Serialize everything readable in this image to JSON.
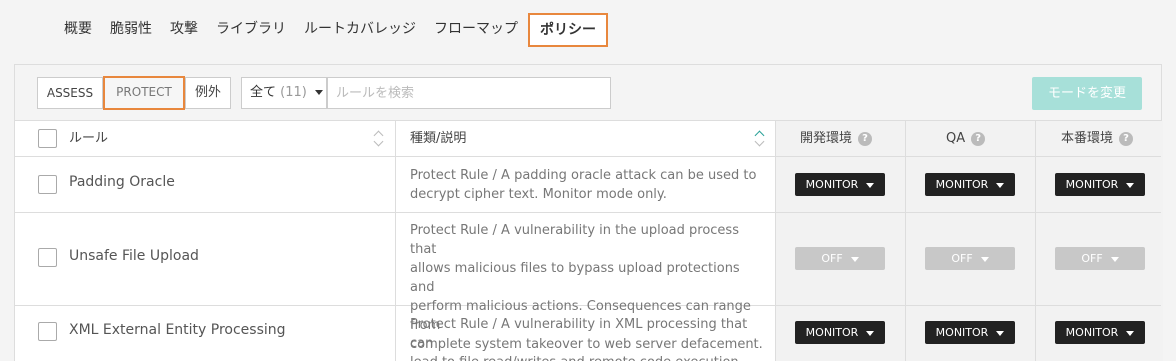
{
  "tabs": [
    {
      "label": "概要"
    },
    {
      "label": "脆弱性"
    },
    {
      "label": "攻撃"
    },
    {
      "label": "ライブラリ"
    },
    {
      "label": "ルートカバレッジ"
    },
    {
      "label": "フローマップ"
    },
    {
      "label": "ポリシー"
    }
  ],
  "toolbar": {
    "assess": "ASSESS",
    "protect": "PROTECT",
    "exceptions": "例外",
    "filter_label": "全て",
    "filter_count": "(11)",
    "search_placeholder": "ルールを検索",
    "mode_button": "モードを変更"
  },
  "table": {
    "headers": {
      "rule": "ルール",
      "type_desc": "種類/説明",
      "dev": "開発環境",
      "qa": "QA",
      "prod": "本番環境"
    },
    "help_icon": "?",
    "rows": [
      {
        "name": "Padding Oracle",
        "desc_lines": [
          "Protect Rule / A padding oracle attack can be used to",
          "decrypt cipher text. Monitor mode only."
        ],
        "dev": "MONITOR",
        "qa": "MONITOR",
        "prod": "MONITOR"
      },
      {
        "name": "Unsafe File Upload",
        "desc_lines": [
          "Protect Rule / A vulnerability in the upload process that",
          "allows malicious files to bypass upload protections and",
          "perform malicious actions. Consequences can range from",
          "complete system takeover to web server defacement."
        ],
        "dev": "OFF",
        "qa": "OFF",
        "prod": "OFF"
      },
      {
        "name": "XML External Entity Processing",
        "desc_lines": [
          "Protect Rule / A vulnerability in XML processing that can",
          "lead to file read/writes and remote code execution."
        ],
        "dev": "MONITOR",
        "qa": "MONITOR",
        "prod": "MONITOR"
      }
    ]
  },
  "colors": {
    "highlight": "#e8873d",
    "accent": "#2aa198",
    "mode_button": "#a7e0d9",
    "monitor": "#222222",
    "off": "#c8c8c8"
  }
}
